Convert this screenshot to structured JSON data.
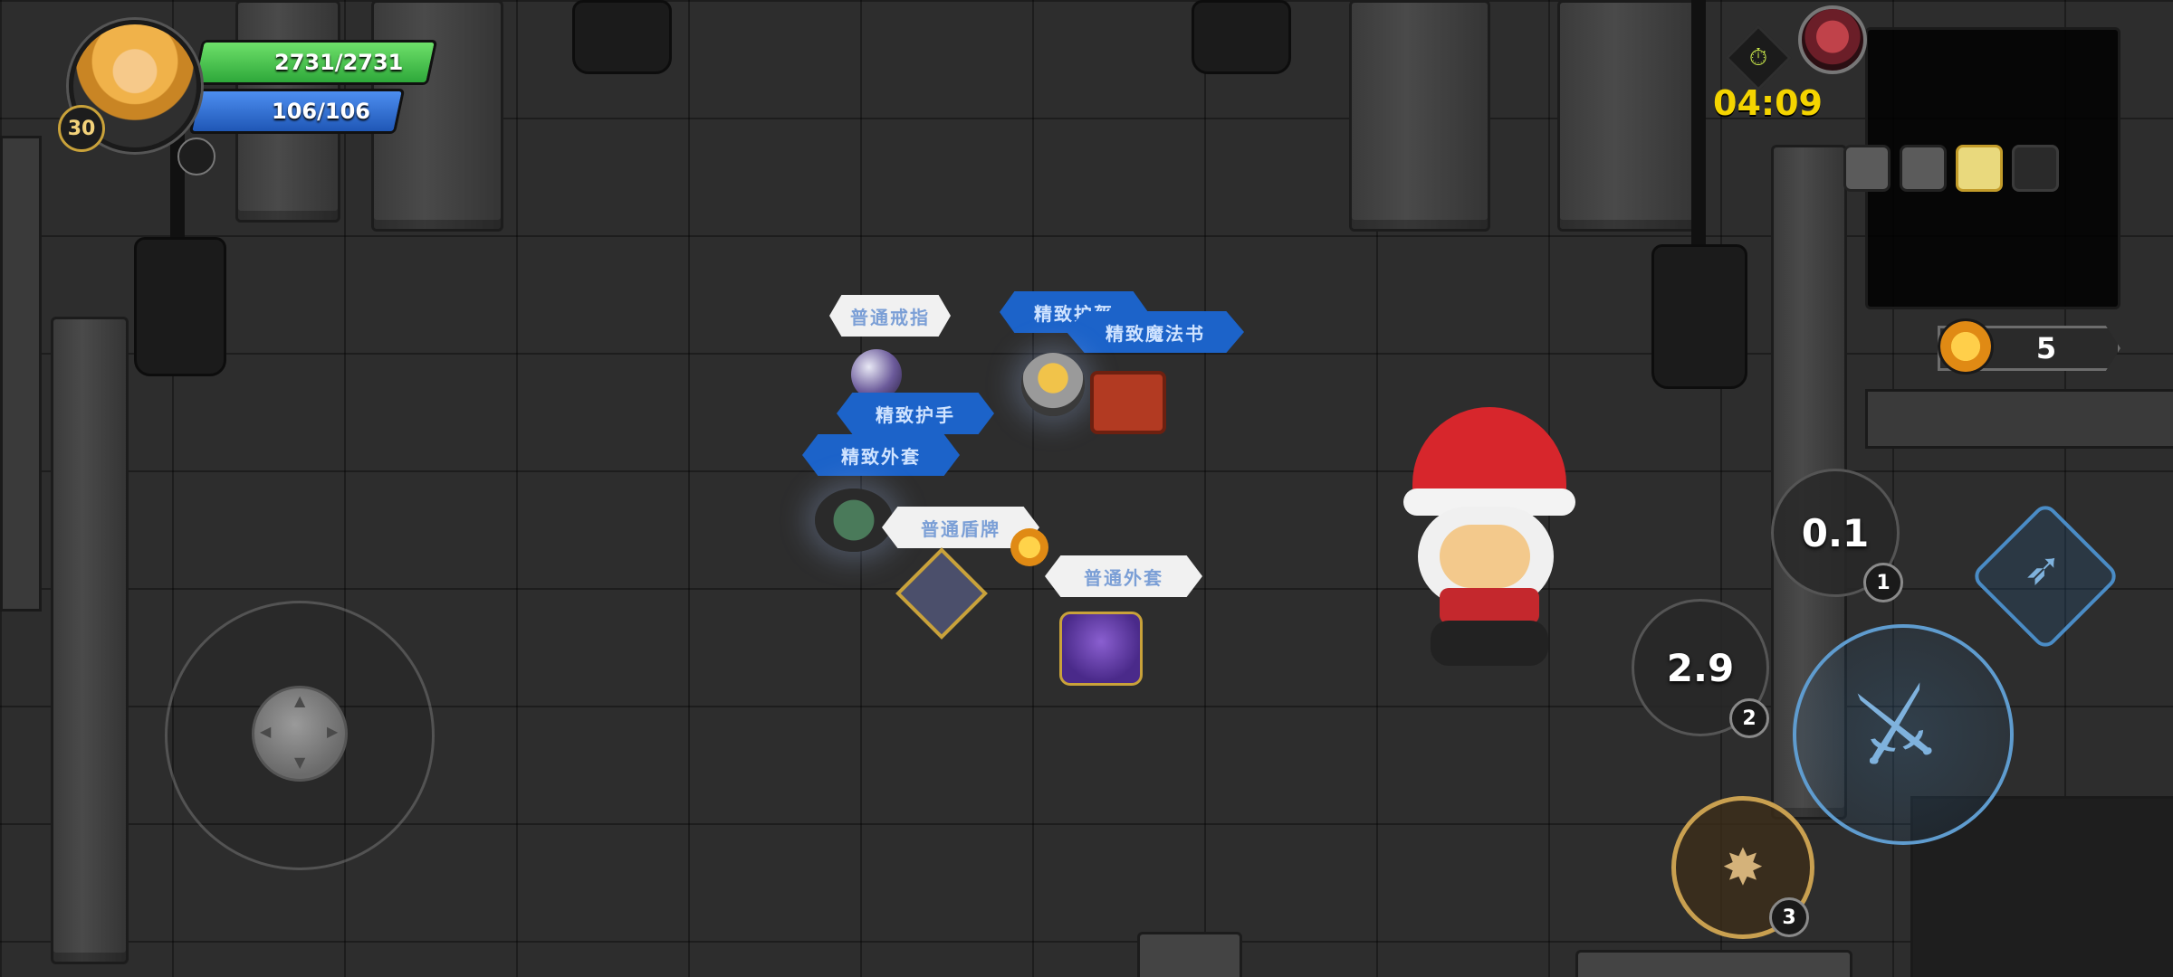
{
  "player": {
    "level": "30",
    "hp": "2731/2731",
    "hp_fraction": 1.0,
    "mp": "106/106",
    "mp_fraction": 1.0
  },
  "timer": {
    "text": "04:09"
  },
  "currency": {
    "coins": "5"
  },
  "skills": {
    "skill1": {
      "cooldown": "0.1",
      "number": "1"
    },
    "skill2": {
      "cooldown": "2.9",
      "number": "2"
    },
    "skill3": {
      "number": "3"
    }
  },
  "loot": {
    "ring_label": "普通戒指",
    "gloves_label": "精致护手",
    "armor_elite_label": "精致外套",
    "helmet_label": "精致护盔",
    "spellbook_label": "精致魔法书",
    "shield_label": "普通盾牌",
    "coat_label": "普通外套"
  },
  "colors": {
    "hp": "#43c04a",
    "mp": "#2f6fd1",
    "timer": "#f4d400",
    "common_tag": "#f1f1f1",
    "elite_tag": "#1c63c9"
  },
  "icons": {
    "timer": "stopwatch-icon",
    "boss": "demon-face-icon",
    "coin": "crown-coin-icon",
    "attack": "sword-icon",
    "dash": "dash-icon",
    "skill3": "shield-web-icon"
  }
}
